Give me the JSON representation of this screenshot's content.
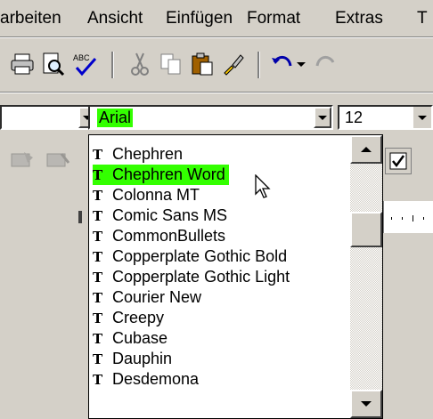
{
  "menu": {
    "items": [
      "arbeiten",
      "Ansicht",
      "Einfügen",
      "Format",
      "Extras",
      "T"
    ]
  },
  "font_combo": {
    "value": "Arial"
  },
  "size_combo": {
    "value": "12"
  },
  "font_list": {
    "items": [
      "Chephren",
      "Chephren Word",
      "Colonna MT",
      "Comic Sans MS",
      "CommonBullets",
      "Copperplate Gothic Bold",
      "Copperplate Gothic Light",
      "Courier New",
      "Creepy",
      "Cubase",
      "Dauphin",
      "Desdemona"
    ],
    "selected": "Chephren Word",
    "truetype_glyph": "T"
  },
  "colors": {
    "highlight": "#33ff00",
    "chrome": "#d4d0c8"
  }
}
